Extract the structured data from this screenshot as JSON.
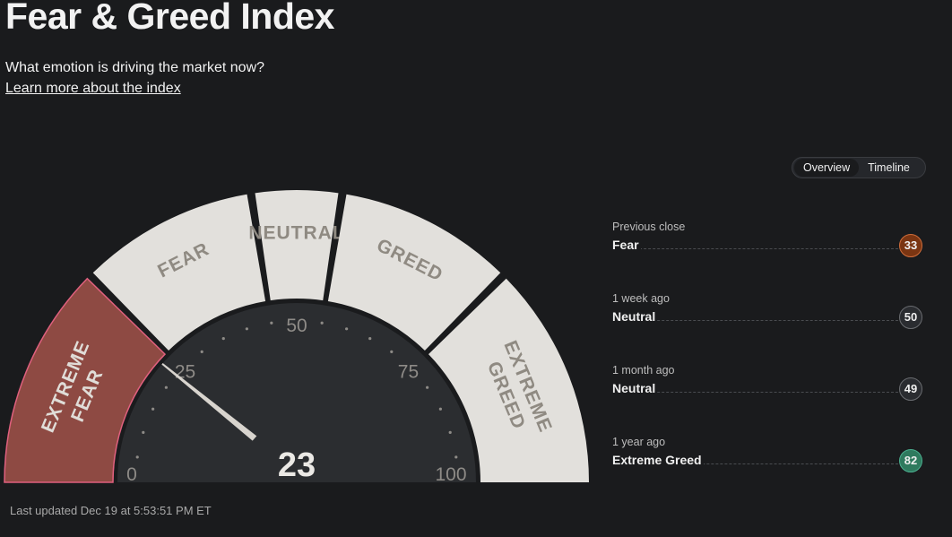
{
  "header": {
    "title": "Fear & Greed Index",
    "subtitle": "What emotion is driving the market now?",
    "learn_link": "Learn more about the index"
  },
  "toggle": {
    "overview": "Overview",
    "timeline": "Timeline",
    "active": "Overview"
  },
  "gauge": {
    "value": "23",
    "segments": [
      {
        "line1": "EXTREME",
        "line2": "FEAR",
        "from": 0,
        "to": 25,
        "active": true
      },
      {
        "line1": "FEAR",
        "line2": "",
        "from": 25,
        "to": 45,
        "active": false
      },
      {
        "line1": "NEUTRAL",
        "line2": "",
        "from": 45,
        "to": 55,
        "active": false
      },
      {
        "line1": "GREED",
        "line2": "",
        "from": 55,
        "to": 75,
        "active": false
      },
      {
        "line1": "EXTREME",
        "line2": "GREED",
        "from": 75,
        "to": 100,
        "active": false
      }
    ],
    "ticks": [
      "0",
      "25",
      "50",
      "75",
      "100"
    ],
    "colors": {
      "segment": "#e2e0dc",
      "active_segment": "#8e4a43",
      "active_border": "#e0607e",
      "needle": "#d8d4ce",
      "inner": "#2b2d30"
    }
  },
  "last_updated": "Last updated Dec 19 at 5:53:51 PM ET",
  "history": [
    {
      "label": "Previous close",
      "rating": "Fear",
      "value": "33",
      "color": "#7a3512",
      "border": "#d06d3a"
    },
    {
      "label": "1 week ago",
      "rating": "Neutral",
      "value": "50",
      "color": "#2a2c30",
      "border": "#6a6c70"
    },
    {
      "label": "1 month ago",
      "rating": "Neutral",
      "value": "49",
      "color": "#2a2c30",
      "border": "#6a6c70"
    },
    {
      "label": "1 year ago",
      "rating": "Extreme Greed",
      "value": "82",
      "color": "#2f7a5e",
      "border": "#4bb090"
    }
  ]
}
